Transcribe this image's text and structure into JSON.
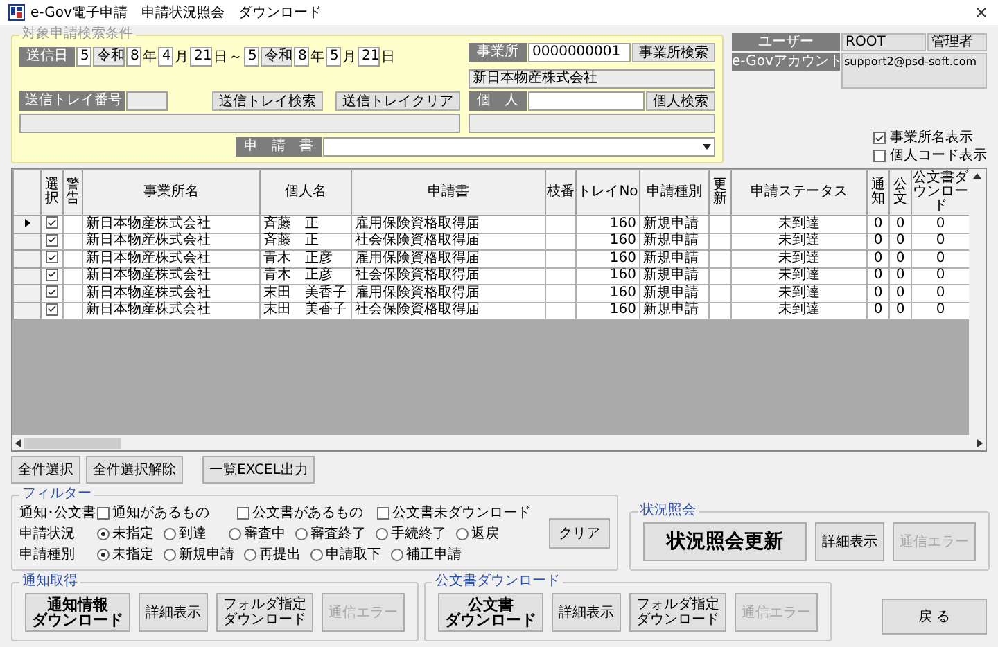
{
  "window": {
    "title": "e-Gov電子申請　申請状況照会　ダウンロード"
  },
  "search": {
    "legend": "対象申請検索条件",
    "date": {
      "label": "送信日",
      "separator": "～",
      "from": [
        {
          "kind": "field",
          "text": "5"
        },
        {
          "kind": "era",
          "text": "令和"
        },
        {
          "kind": "field",
          "text": "8"
        },
        {
          "kind": "unit",
          "text": "年"
        },
        {
          "kind": "field",
          "text": "4"
        },
        {
          "kind": "unit",
          "text": "月"
        },
        {
          "kind": "field",
          "text": "21"
        },
        {
          "kind": "unit",
          "text": "日"
        }
      ],
      "to": [
        {
          "kind": "field",
          "text": "5"
        },
        {
          "kind": "era",
          "text": "令和"
        },
        {
          "kind": "field",
          "text": "8"
        },
        {
          "kind": "unit",
          "text": "年"
        },
        {
          "kind": "field",
          "text": "5"
        },
        {
          "kind": "unit",
          "text": "月"
        },
        {
          "kind": "field",
          "text": "21"
        },
        {
          "kind": "unit",
          "text": "日"
        }
      ]
    },
    "office": {
      "label": "事業所",
      "code": "0000000001",
      "button": "事業所検索",
      "name": "新日本物産株式会社"
    },
    "tray": {
      "label": "送信トレイ番号",
      "buttons": [
        "送信トレイ検索",
        "送信トレイクリア"
      ]
    },
    "person": {
      "label": "個　人",
      "button": "個人検索"
    },
    "form": {
      "label": "申　請　書"
    }
  },
  "user": {
    "label": "ユーザー",
    "id": "ROOT",
    "role": "管理者"
  },
  "account": {
    "label": "e-Govアカウント",
    "value": "support2@psd-soft.com"
  },
  "options": [
    {
      "label": "事業所名表示",
      "checked": true
    },
    {
      "label": "個人コード表示",
      "checked": false
    }
  ],
  "table": {
    "columns": [
      "選択",
      "警告",
      "事業所名",
      "個人名",
      "申請書",
      "枝番",
      "トレイNo",
      "申請種別",
      "更新",
      "申請ステータス",
      "通知",
      "公文",
      "公文書ダウンロード"
    ],
    "rows": [
      {
        "selected": true,
        "checked": true,
        "office": "新日本物産株式会社",
        "person": "斉藤　正",
        "form": "雇用保険資格取得届",
        "tray": "160",
        "type": "新規申請",
        "status": "未到達",
        "notice": "0",
        "document": "0",
        "download": "0"
      },
      {
        "selected": false,
        "checked": true,
        "office": "新日本物産株式会社",
        "person": "斉藤　正",
        "form": "社会保険資格取得届",
        "tray": "160",
        "type": "新規申請",
        "status": "未到達",
        "notice": "0",
        "document": "0",
        "download": "0"
      },
      {
        "selected": false,
        "checked": true,
        "office": "新日本物産株式会社",
        "person": "青木　正彦",
        "form": "雇用保険資格取得届",
        "tray": "160",
        "type": "新規申請",
        "status": "未到達",
        "notice": "0",
        "document": "0",
        "download": "0"
      },
      {
        "selected": false,
        "checked": true,
        "office": "新日本物産株式会社",
        "person": "青木　正彦",
        "form": "社会保険資格取得届",
        "tray": "160",
        "type": "新規申請",
        "status": "未到達",
        "notice": "0",
        "document": "0",
        "download": "0"
      },
      {
        "selected": false,
        "checked": true,
        "office": "新日本物産株式会社",
        "person": "末田　美香子",
        "form": "雇用保険資格取得届",
        "tray": "160",
        "type": "新規申請",
        "status": "未到達",
        "notice": "0",
        "document": "0",
        "download": "0"
      },
      {
        "selected": false,
        "checked": true,
        "office": "新日本物産株式会社",
        "person": "末田　美香子",
        "form": "社会保険資格取得届",
        "tray": "160",
        "type": "新規申請",
        "status": "未到達",
        "notice": "0",
        "document": "0",
        "download": "0"
      }
    ]
  },
  "list_buttons": [
    "全件選択",
    "全件選択解除",
    "一覧EXCEL出力"
  ],
  "filter": {
    "legend": "フィルター",
    "clear": "クリア",
    "rows": [
      {
        "label": "通知･公文書",
        "kind": "checkbox",
        "options": [
          {
            "label": "通知があるもの",
            "checked": false
          },
          {
            "label": "公文書があるもの",
            "checked": false
          },
          {
            "label": "公文書未ダウンロード",
            "checked": false
          }
        ]
      },
      {
        "label": "申請状況",
        "kind": "radio",
        "options": [
          {
            "label": "未指定",
            "selected": true
          },
          {
            "label": "到達",
            "selected": false
          },
          {
            "label": "審査中",
            "selected": false
          },
          {
            "label": "審査終了",
            "selected": false
          },
          {
            "label": "手続終了",
            "selected": false
          },
          {
            "label": "返戻",
            "selected": false
          }
        ]
      },
      {
        "label": "申請種別",
        "kind": "radio",
        "options": [
          {
            "label": "未指定",
            "selected": true
          },
          {
            "label": "新規申請",
            "selected": false
          },
          {
            "label": "再提出",
            "selected": false
          },
          {
            "label": "申請取下",
            "selected": false
          },
          {
            "label": "補正申請",
            "selected": false
          }
        ]
      }
    ]
  },
  "status_query": {
    "legend": "状況照会",
    "buttons": [
      {
        "lines": [
          "状況照会更新"
        ],
        "kind": "large",
        "disabled": false
      },
      {
        "lines": [
          "詳細表示"
        ],
        "kind": "normal",
        "disabled": false
      },
      {
        "lines": [
          "通信エラー"
        ],
        "kind": "normal",
        "disabled": true
      }
    ]
  },
  "notice": {
    "legend": "通知取得",
    "buttons": [
      {
        "lines": [
          "通知情報",
          "ダウンロード"
        ],
        "kind": "bold",
        "disabled": false
      },
      {
        "lines": [
          "詳細表示"
        ],
        "kind": "normal",
        "disabled": false
      },
      {
        "lines": [
          "フォルダ指定",
          "ダウンロード"
        ],
        "kind": "normal",
        "disabled": false
      },
      {
        "lines": [
          "通信エラー"
        ],
        "kind": "normal",
        "disabled": true
      }
    ]
  },
  "documents": {
    "legend": "公文書ダウンロード",
    "buttons": [
      {
        "lines": [
          "公文書",
          "ダウンロード"
        ],
        "kind": "bold",
        "disabled": false
      },
      {
        "lines": [
          "詳細表示"
        ],
        "kind": "normal",
        "disabled": false
      },
      {
        "lines": [
          "フォルダ指定",
          "ダウンロード"
        ],
        "kind": "normal",
        "disabled": false
      },
      {
        "lines": [
          "通信エラー"
        ],
        "kind": "normal",
        "disabled": true
      }
    ]
  },
  "back_button": "戻 る"
}
